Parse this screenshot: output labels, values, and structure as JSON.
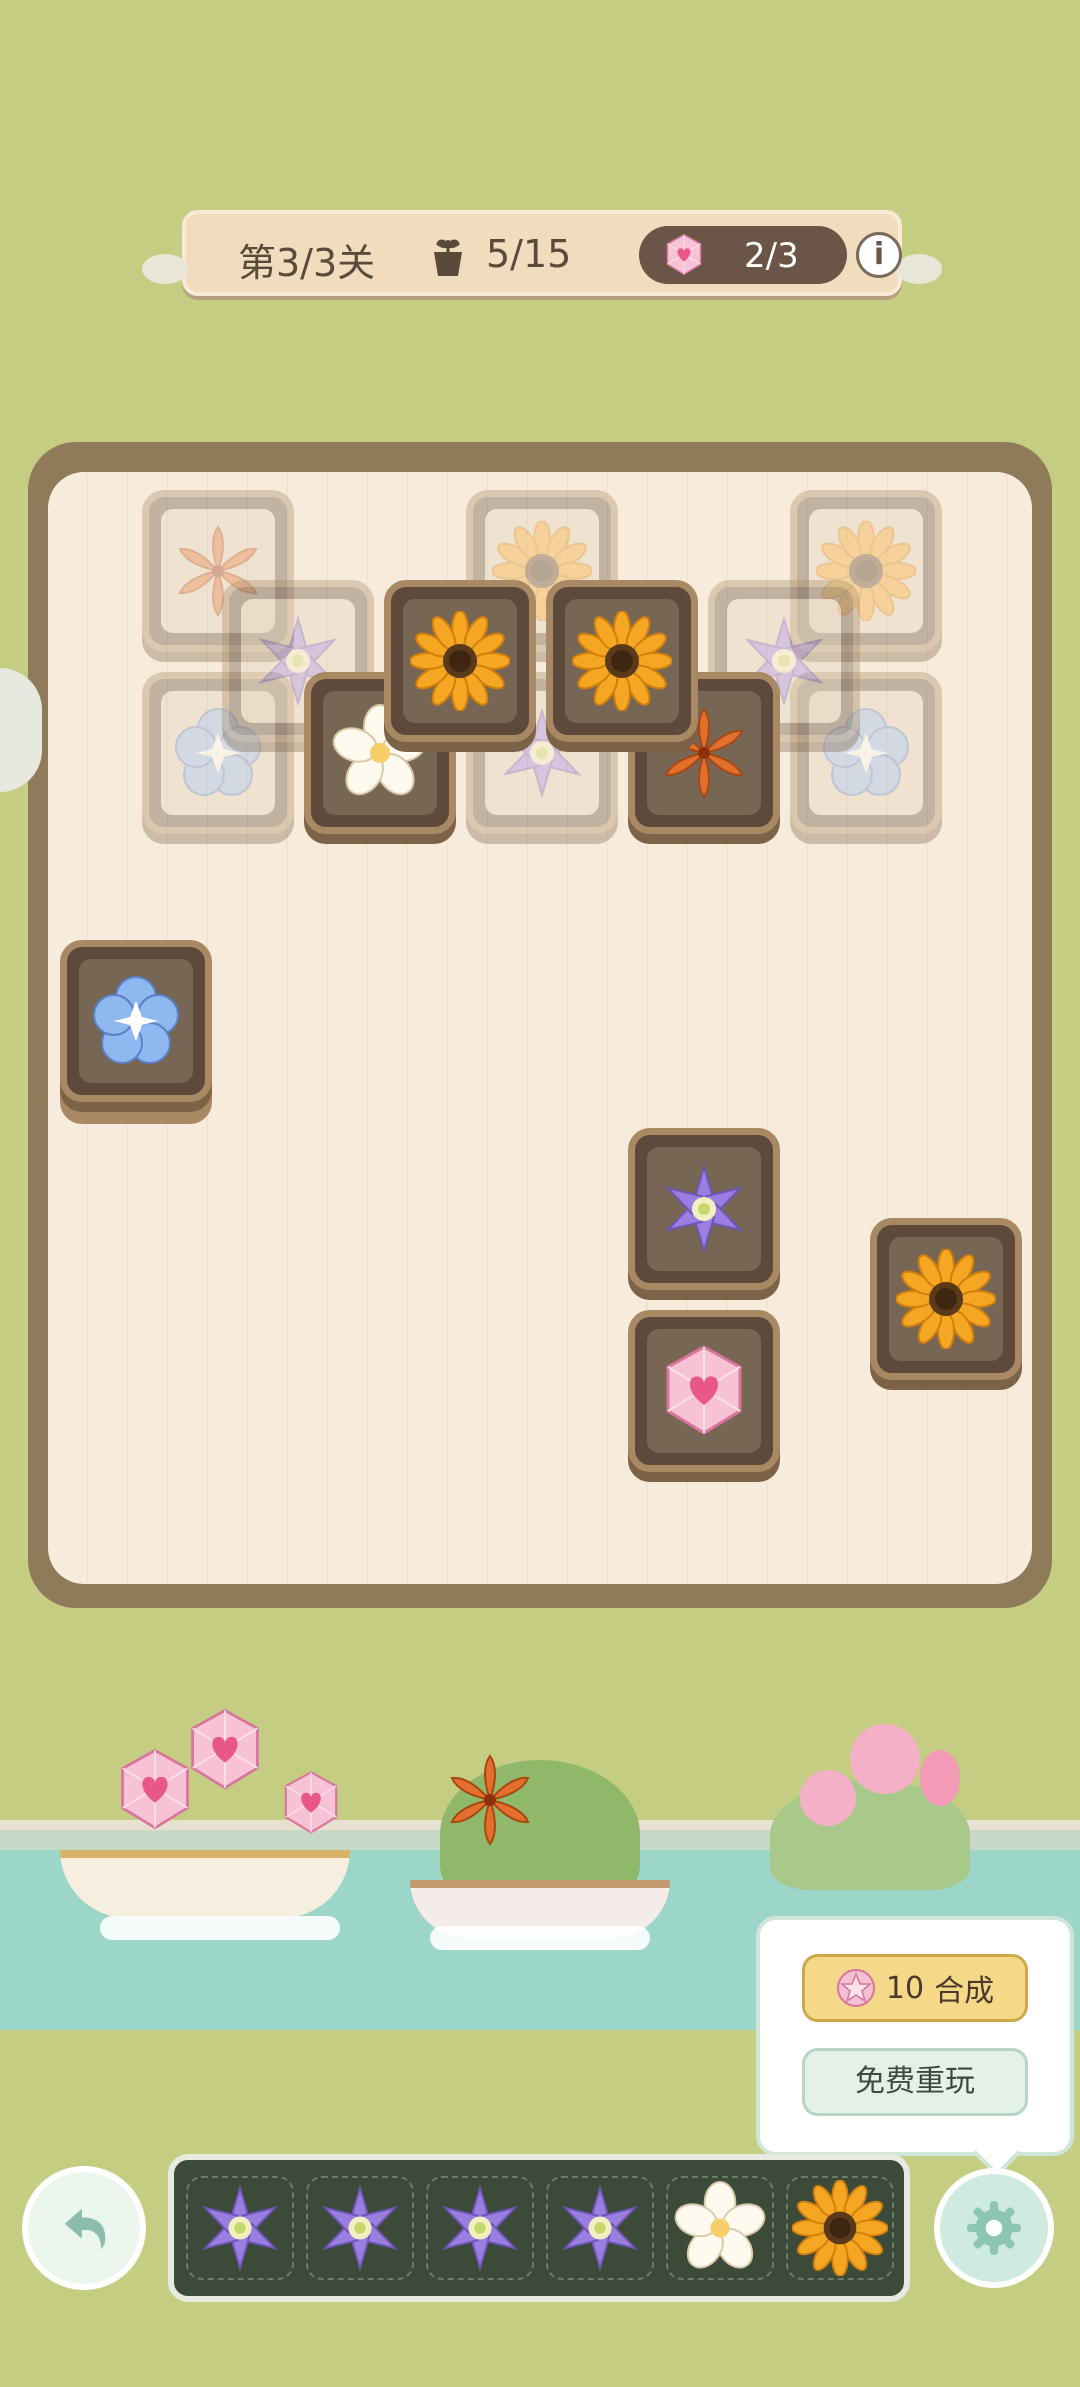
{
  "header": {
    "level": "第3/3关",
    "goal": "5/15",
    "gems": "2/3",
    "info": "i"
  },
  "icons": {
    "goal": "flower-pot-icon",
    "gem": "pink-heart-gem-icon",
    "info": "info-icon",
    "undo": "undo-arrow-icon",
    "settings": "gear-icon"
  },
  "popup": {
    "merge_cost": "10",
    "merge_label": "合成",
    "replay_label": "免费重玩"
  },
  "board": {
    "tiles": [
      {
        "type": "lily",
        "state": "covered"
      },
      {
        "type": "sunflower",
        "state": "covered"
      },
      {
        "type": "sunflower",
        "state": "covered"
      },
      {
        "type": "clematis",
        "state": "covered"
      },
      {
        "type": "clematis",
        "state": "covered"
      },
      {
        "type": "blue-pansy",
        "state": "covered"
      },
      {
        "type": "plumeria",
        "state": "open"
      },
      {
        "type": "sunflower",
        "state": "open"
      },
      {
        "type": "sunflower",
        "state": "open"
      },
      {
        "type": "clematis",
        "state": "covered"
      },
      {
        "type": "lily",
        "state": "open"
      },
      {
        "type": "blue-pansy",
        "state": "covered"
      },
      {
        "type": "blue-morning-glory",
        "state": "open"
      },
      {
        "type": "clematis",
        "state": "open"
      },
      {
        "type": "sunflower",
        "state": "open"
      },
      {
        "type": "pink-gem",
        "state": "open"
      }
    ]
  },
  "tray": {
    "slots": [
      "clematis",
      "clematis",
      "clematis",
      "clematis",
      "plumeria",
      "sunflower"
    ]
  },
  "colors": {
    "background": "#c5cd82",
    "board_frame": "#8f7a5a",
    "tile_frame": "#a88964"
  }
}
